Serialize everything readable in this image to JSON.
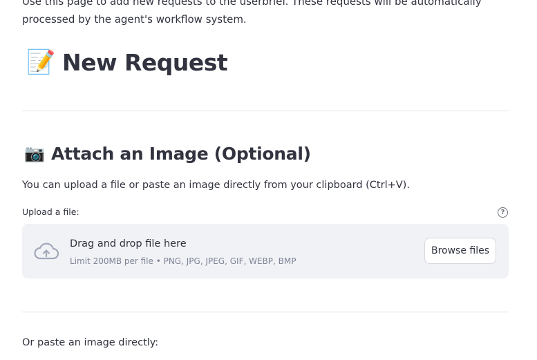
{
  "intro": {
    "text": "Use this page to add new requests to the userbrief. These requests will be automatically processed by the agent's workflow system."
  },
  "new_request": {
    "emoji": "📝",
    "title": "New Request"
  },
  "attach": {
    "emoji": "📷",
    "title": "Attach an Image (Optional)",
    "description": "You can upload a file or paste an image directly from your clipboard (Ctrl+V)."
  },
  "uploader": {
    "label": "Upload a file:",
    "help_glyph": "?",
    "dropzone_title": "Drag and drop file here",
    "dropzone_limit": "Limit 200MB per file • PNG, JPG, JPEG, GIF, WEBP, BMP",
    "browse_label": "Browse files"
  },
  "paste": {
    "label": "Or paste an image directly:"
  },
  "colors": {
    "text": "#31333f",
    "muted": "#808495",
    "dropzone_bg": "#f0f2f6",
    "divider": "#dfe1e5",
    "icon": "#a3a8b8"
  },
  "icons": {
    "help": "help-circle-icon",
    "upload": "cloud-upload-icon"
  }
}
